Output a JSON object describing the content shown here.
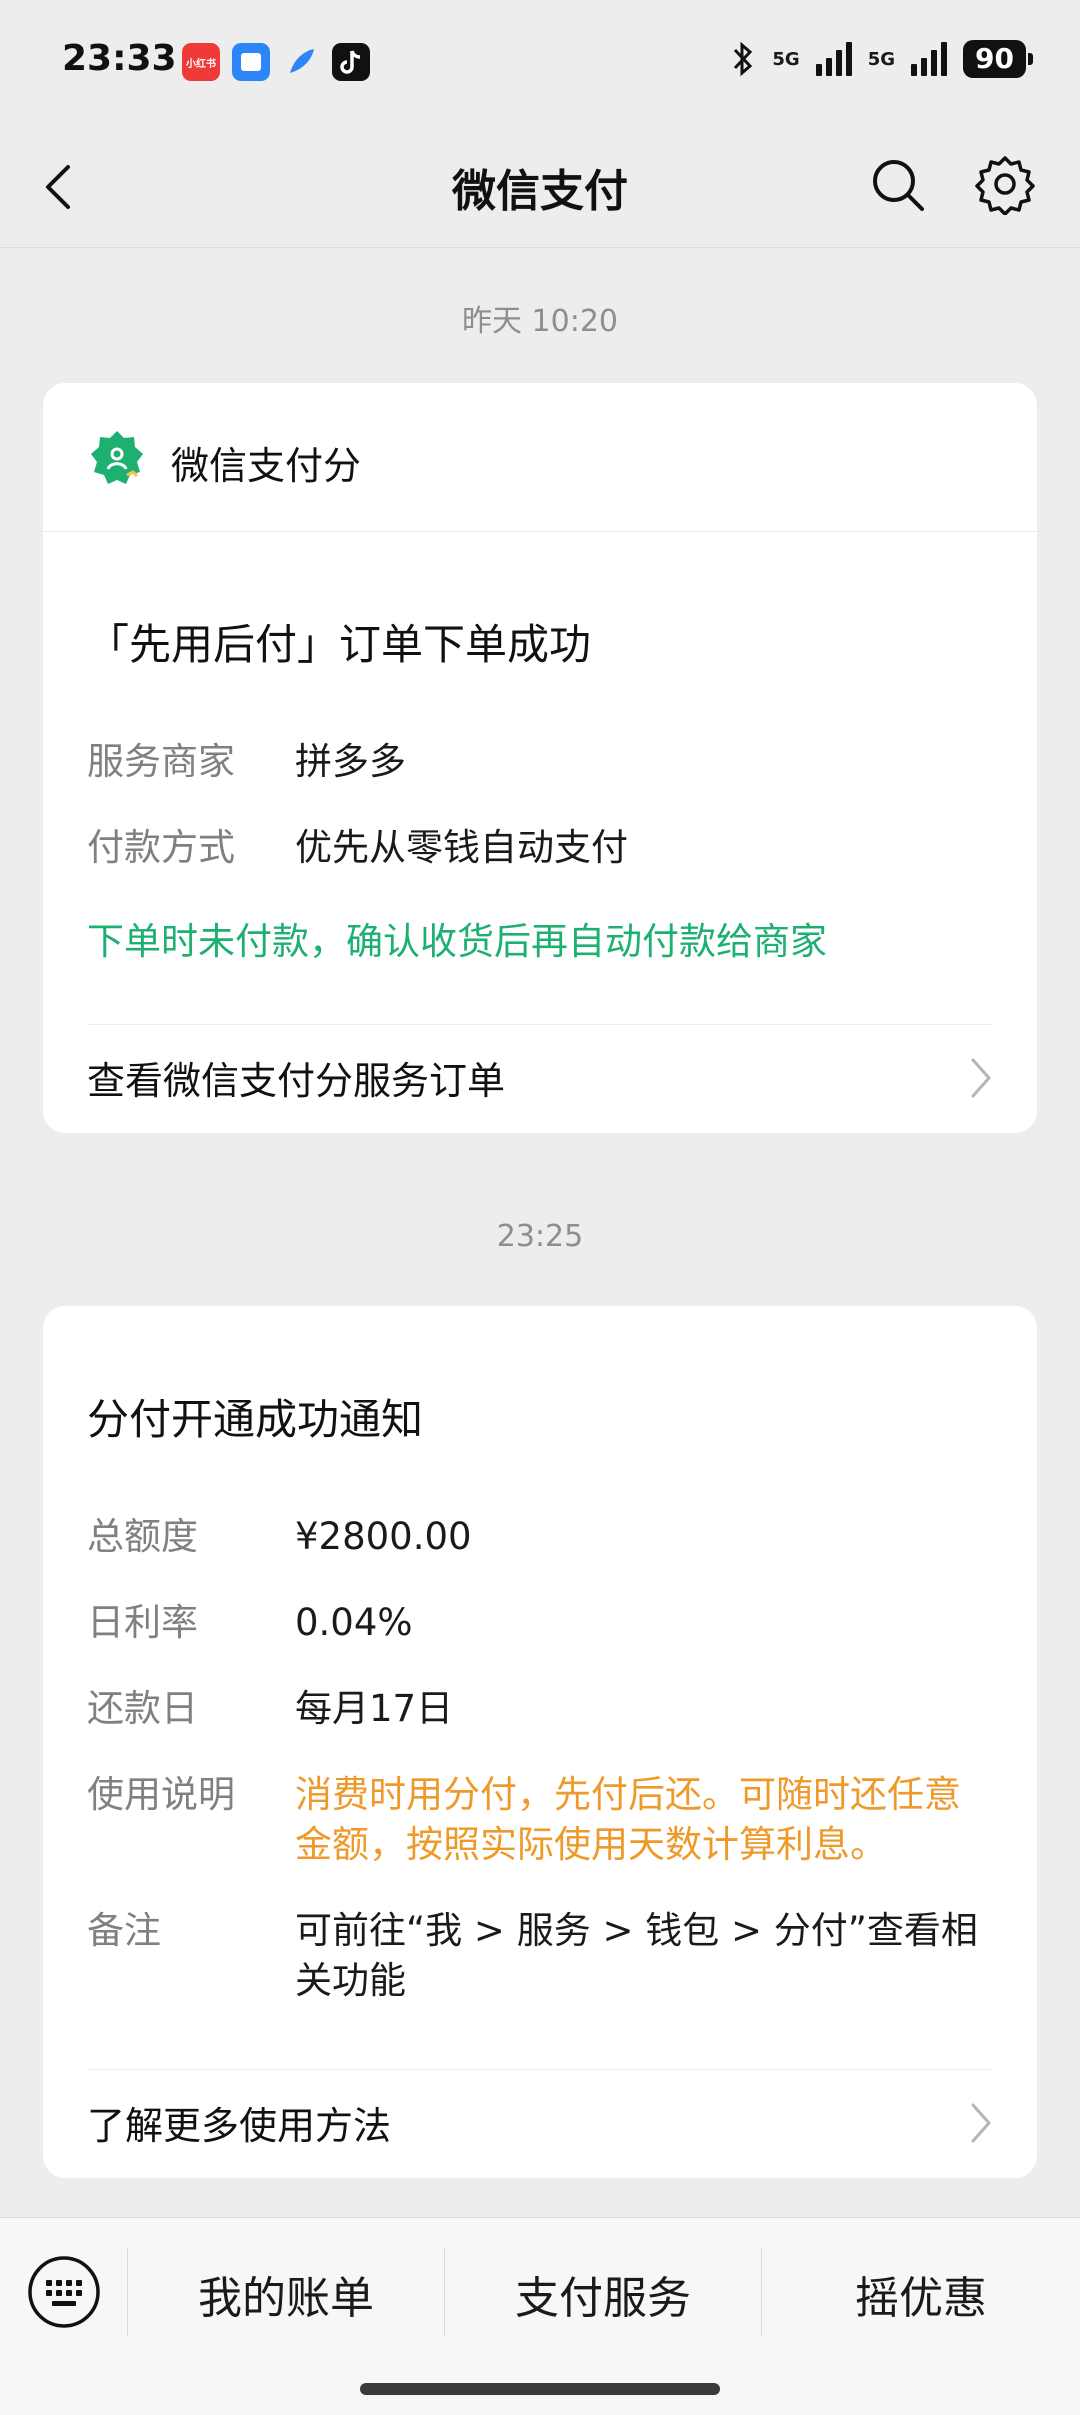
{
  "status_bar": {
    "time": "23:33",
    "app_icons": [
      "小红书",
      "files-icon",
      "feather-icon",
      "tiktok-icon"
    ],
    "signal_1": "5G",
    "signal_2": "5G",
    "battery": "90"
  },
  "nav": {
    "title": "微信支付"
  },
  "messages": [
    {
      "time": "昨天 10:20",
      "brand": "微信支付分",
      "title": "「先用后付」订单下单成功",
      "rows": [
        {
          "label": "服务商家",
          "value": "拼多多"
        },
        {
          "label": "付款方式",
          "value": "优先从零钱自动支付"
        }
      ],
      "note": "下单时未付款，确认收货后再自动付款给商家",
      "link": "查看微信支付分服务订单"
    },
    {
      "time": "23:25",
      "title": "分付开通成功通知",
      "rows": [
        {
          "label": "总额度",
          "value": "¥2800.00"
        },
        {
          "label": "日利率",
          "value": "0.04%"
        },
        {
          "label": "还款日",
          "value": "每月17日"
        },
        {
          "label": "使用说明",
          "value": "消费时用分付，先付后还。可随时还任意金额，按照实际使用天数计算利息。"
        },
        {
          "label": "备注",
          "value": "可前往“我 > 服务 > 钱包 > 分付”查看相关功能"
        }
      ],
      "link": "了解更多使用方法"
    }
  ],
  "bottom_tabs": [
    "我的账单",
    "支付服务",
    "摇优惠"
  ],
  "colors": {
    "accent_green": "#1eb070",
    "accent_orange": "#ee9a2b",
    "background": "#ededed"
  }
}
